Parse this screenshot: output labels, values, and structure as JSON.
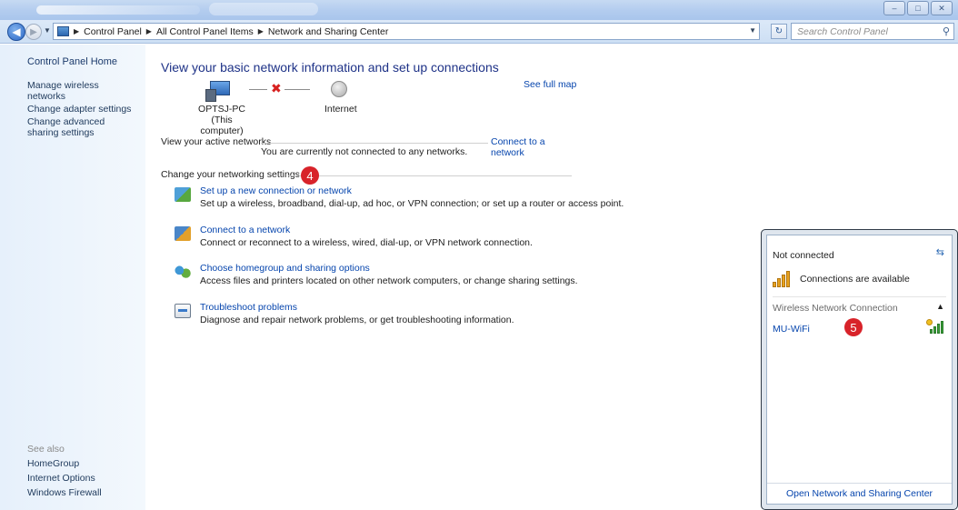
{
  "window": {
    "title_blurred": true,
    "buttons": [
      "–",
      "□",
      "✕"
    ]
  },
  "address": {
    "crumbs": [
      "Control Panel",
      "All Control Panel Items",
      "Network and Sharing Center"
    ],
    "search_placeholder": "Search Control Panel"
  },
  "sidebar": {
    "home": "Control Panel Home",
    "links": [
      "Manage wireless networks",
      "Change adapter settings",
      "Change advanced sharing settings"
    ],
    "see_also": "See also",
    "see_also_links": [
      "HomeGroup",
      "Internet Options",
      "Windows Firewall"
    ]
  },
  "main": {
    "title": "View your basic network information and set up connections",
    "see_full_map": "See full map",
    "computer_name": "OPTSJ-PC",
    "computer_sub": "(This computer)",
    "internet_label": "Internet",
    "active_networks_label": "View your active networks",
    "not_connected_msg": "You are currently not connected to any networks.",
    "connect_link": "Connect to a network",
    "change_settings_label": "Change your networking settings",
    "step_badge": "4",
    "tasks": [
      {
        "link": "Set up a new connection or network",
        "desc": "Set up a wireless, broadband, dial-up, ad hoc, or VPN connection; or set up a router or access point."
      },
      {
        "link": "Connect to a network",
        "desc": "Connect or reconnect to a wireless, wired, dial-up, or VPN network connection."
      },
      {
        "link": "Choose homegroup and sharing options",
        "desc": "Access files and printers located on other network computers, or change sharing settings."
      },
      {
        "link": "Troubleshoot problems",
        "desc": "Diagnose and repair network problems, or get troubleshooting information."
      }
    ]
  },
  "popup": {
    "status": "Not connected",
    "available": "Connections are available",
    "section": "Wireless Network Connection",
    "network_name": "MU-WiFi",
    "step_badge": "5",
    "footer_link": "Open Network and Sharing Center"
  },
  "colors": {
    "link": "#0645ad",
    "title": "#1e3287",
    "badge": "#d8232a",
    "sidebar_bg": "#e6f0fb"
  }
}
